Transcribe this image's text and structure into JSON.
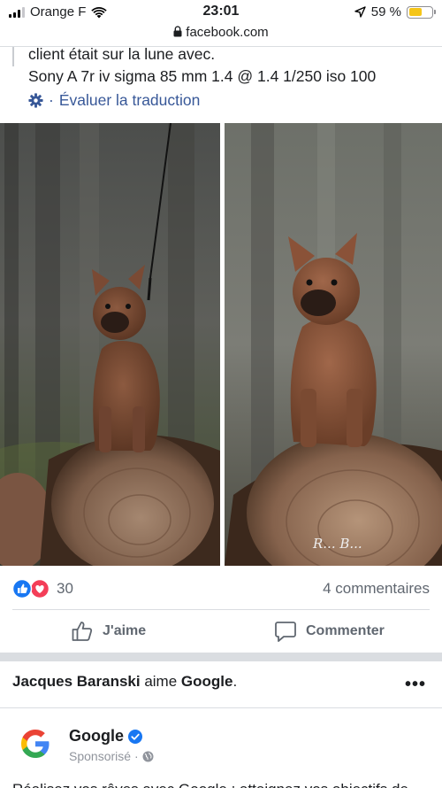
{
  "status_bar": {
    "carrier": "Orange F",
    "time": "23:01",
    "battery_percent": "59 %",
    "battery_level": 0.59
  },
  "browser": {
    "url": "facebook.com"
  },
  "post": {
    "text_line1": "client était sur la lune avec.",
    "text_line2": "Sony A 7r iv sigma 85 mm 1.4 @ 1.4 1/250 iso 100",
    "translate_link": "Évaluer la traduction",
    "translate_separator": "·",
    "watermark": "R... B...",
    "reaction_count": "30",
    "comment_count": "4 commentaires",
    "like_label": "J'aime",
    "comment_label": "Commenter"
  },
  "next_story": {
    "actor": "Jacques Baranski",
    "verb": " aime ",
    "target": "Google",
    "end": ".",
    "more": "•••",
    "page_name": "Google",
    "sponsored": "Sponsorisé",
    "sponsored_sep": "·",
    "cut_text": "Réalisez vos rêves avec Google : atteignez vos objectifs de"
  },
  "colors": {
    "link": "#385898",
    "like_blue": "#1877f2",
    "love_red": "#f33e58",
    "verified_blue": "#1877f2"
  },
  "icons": [
    "signal-icon",
    "wifi-icon",
    "location-arrow-icon",
    "lock-icon",
    "gear-icon",
    "like-reaction-icon",
    "love-reaction-icon",
    "thumbs-up-icon",
    "comment-icon",
    "more-icon",
    "google-logo-icon",
    "verified-icon",
    "globe-icon"
  ]
}
